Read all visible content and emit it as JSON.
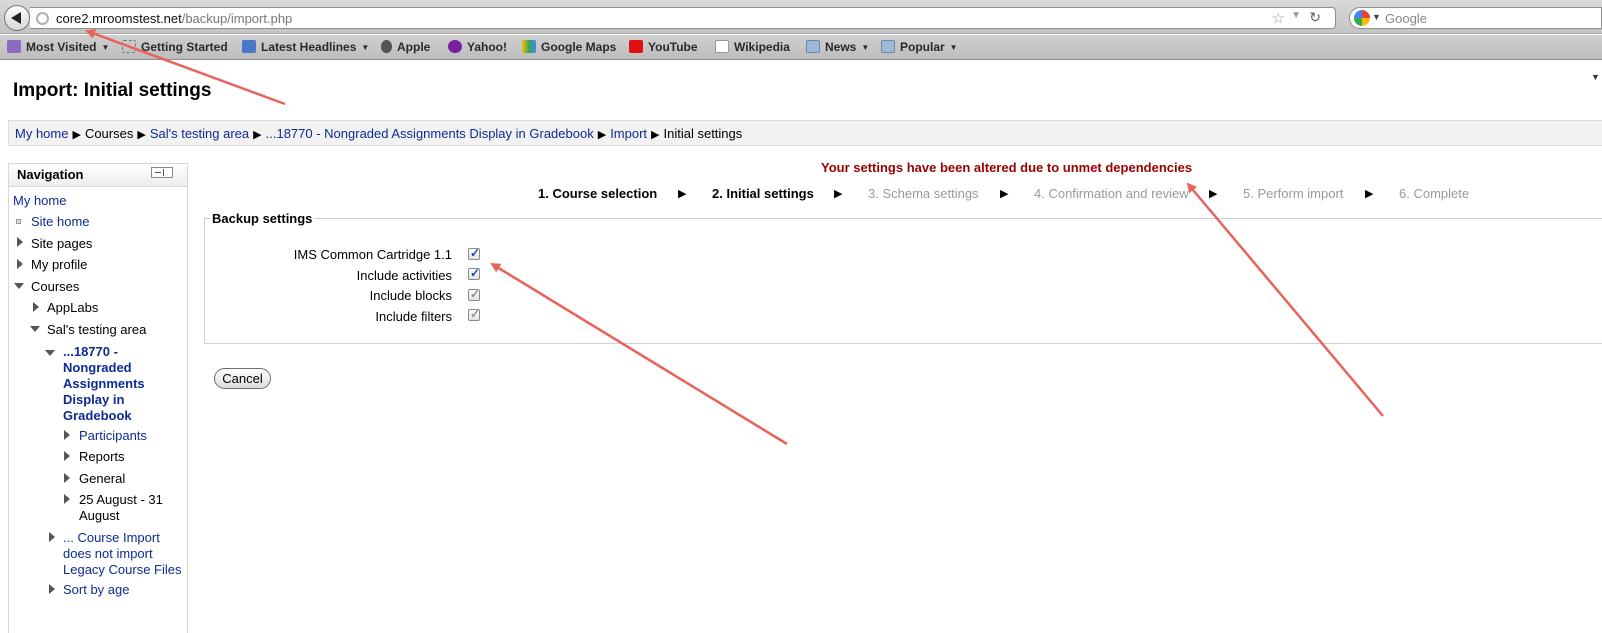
{
  "browser": {
    "url_host": "core2.mroomstest.net",
    "url_path": "/backup/import.php",
    "search_placeholder": "Google",
    "bookmarks": [
      {
        "label": "Most Visited",
        "icon": "most-visited-icon",
        "has_caret": true
      },
      {
        "label": "Getting Started",
        "icon": "getting-started-icon",
        "has_caret": false
      },
      {
        "label": "Latest Headlines",
        "icon": "rss-icon",
        "has_caret": true
      },
      {
        "label": "Apple",
        "icon": "apple-icon",
        "has_caret": false
      },
      {
        "label": "Yahoo!",
        "icon": "yahoo-icon",
        "has_caret": false
      },
      {
        "label": "Google Maps",
        "icon": "google-maps-icon",
        "has_caret": false
      },
      {
        "label": "YouTube",
        "icon": "youtube-icon",
        "has_caret": false
      },
      {
        "label": "Wikipedia",
        "icon": "wikipedia-icon",
        "has_caret": false
      },
      {
        "label": "News",
        "icon": "folder-icon",
        "has_caret": true
      },
      {
        "label": "Popular",
        "icon": "folder-icon",
        "has_caret": true
      }
    ]
  },
  "page": {
    "title": "Import: Initial settings",
    "breadcrumb": [
      {
        "label": "My home",
        "link": true
      },
      {
        "label": "Courses",
        "link": false
      },
      {
        "label": "Sal's testing area",
        "link": true
      },
      {
        "label": "...18770 - Nongraded Assignments Display in Gradebook",
        "link": true
      },
      {
        "label": "Import",
        "link": true
      },
      {
        "label": "Initial settings",
        "link": false
      }
    ]
  },
  "navigation": {
    "title": "Navigation",
    "items": {
      "my_home": "My home",
      "site_home": "Site home",
      "site_pages": "Site pages",
      "my_profile": "My profile",
      "courses": "Courses",
      "applabs": "AppLabs",
      "sals_testing_area": "Sal's testing area",
      "course_line1": "...18770 -",
      "course_line2": "Nongraded",
      "course_line3": "Assignments",
      "course_line4": "Display in",
      "course_line5": "Gradebook",
      "participants": "Participants",
      "reports": "Reports",
      "general": "General",
      "week_line1": "25 August - 31",
      "week_line2": "August",
      "import_line1": "... Course Import",
      "import_line2": "does not import",
      "import_line3": "Legacy Course Files",
      "sort_by_age": "Sort by age"
    }
  },
  "main": {
    "warning": "Your settings have been altered due to unmet dependencies",
    "steps": [
      {
        "label": "1. Course selection",
        "state": "done"
      },
      {
        "label": "2. Initial settings",
        "state": "done"
      },
      {
        "label": "3. Schema settings",
        "state": "todo"
      },
      {
        "label": "4. Confirmation and review",
        "state": "todo"
      },
      {
        "label": "5. Perform import",
        "state": "todo"
      },
      {
        "label": "6. Complete",
        "state": "todo"
      }
    ],
    "backup_settings": {
      "legend": "Backup settings",
      "items": [
        {
          "label": "IMS Common Cartridge 1.1",
          "checked": true,
          "enabled": true
        },
        {
          "label": "Include activities",
          "checked": true,
          "enabled": true
        },
        {
          "label": "Include blocks",
          "checked": true,
          "enabled": false
        },
        {
          "label": "Include filters",
          "checked": true,
          "enabled": false
        }
      ]
    },
    "cancel_label": "Cancel"
  },
  "colors": {
    "link": "#0c2b93",
    "warning": "#9a0000",
    "annotation_arrow": "#e8635a"
  }
}
